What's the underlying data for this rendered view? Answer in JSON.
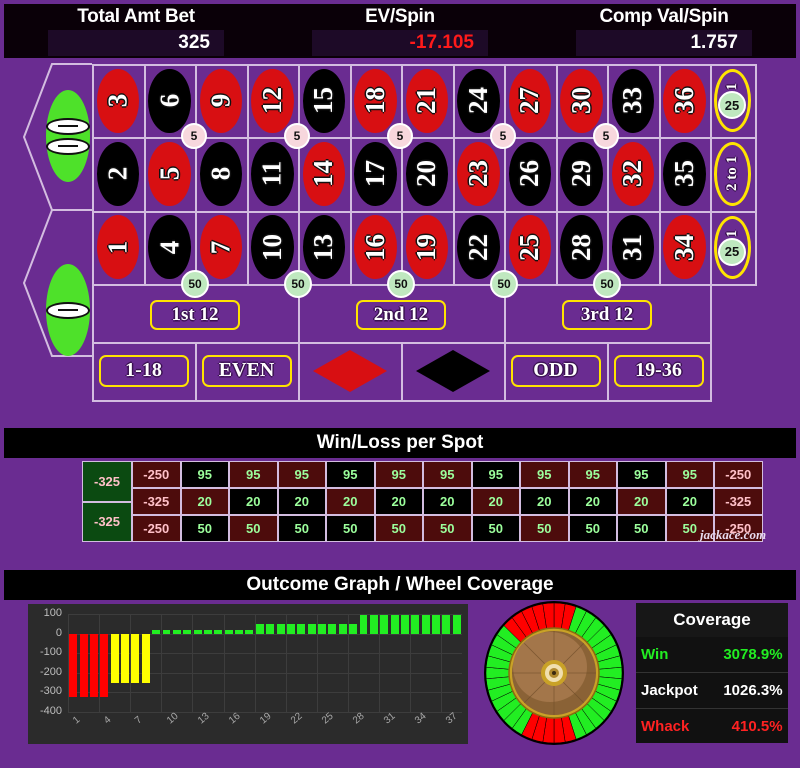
{
  "header": {
    "stats": [
      {
        "label": "Total Amt Bet",
        "value": "325",
        "negative": false
      },
      {
        "label": "EV/Spin",
        "value": "-17.105",
        "negative": true
      },
      {
        "label": "Comp Val/Spin",
        "value": "1.757",
        "negative": false
      }
    ]
  },
  "board": {
    "zeros": [
      {
        "label": "00",
        "zeros": 2
      },
      {
        "label": "0",
        "zeros": 1
      }
    ],
    "numbers": [
      {
        "n": "3",
        "color": "red",
        "col": 0,
        "row": 0
      },
      {
        "n": "6",
        "color": "black",
        "col": 1,
        "row": 0
      },
      {
        "n": "9",
        "color": "red",
        "col": 2,
        "row": 0
      },
      {
        "n": "12",
        "color": "red",
        "col": 3,
        "row": 0
      },
      {
        "n": "15",
        "color": "black",
        "col": 4,
        "row": 0
      },
      {
        "n": "18",
        "color": "red",
        "col": 5,
        "row": 0
      },
      {
        "n": "21",
        "color": "red",
        "col": 6,
        "row": 0
      },
      {
        "n": "24",
        "color": "black",
        "col": 7,
        "row": 0
      },
      {
        "n": "27",
        "color": "red",
        "col": 8,
        "row": 0
      },
      {
        "n": "30",
        "color": "red",
        "col": 9,
        "row": 0
      },
      {
        "n": "33",
        "color": "black",
        "col": 10,
        "row": 0
      },
      {
        "n": "36",
        "color": "red",
        "col": 11,
        "row": 0
      },
      {
        "n": "2",
        "color": "black",
        "col": 0,
        "row": 1
      },
      {
        "n": "5",
        "color": "red",
        "col": 1,
        "row": 1
      },
      {
        "n": "8",
        "color": "black",
        "col": 2,
        "row": 1
      },
      {
        "n": "11",
        "color": "black",
        "col": 3,
        "row": 1
      },
      {
        "n": "14",
        "color": "red",
        "col": 4,
        "row": 1
      },
      {
        "n": "17",
        "color": "black",
        "col": 5,
        "row": 1
      },
      {
        "n": "20",
        "color": "black",
        "col": 6,
        "row": 1
      },
      {
        "n": "23",
        "color": "red",
        "col": 7,
        "row": 1
      },
      {
        "n": "26",
        "color": "black",
        "col": 8,
        "row": 1
      },
      {
        "n": "29",
        "color": "black",
        "col": 9,
        "row": 1
      },
      {
        "n": "32",
        "color": "red",
        "col": 10,
        "row": 1
      },
      {
        "n": "35",
        "color": "black",
        "col": 11,
        "row": 1
      },
      {
        "n": "1",
        "color": "red",
        "col": 0,
        "row": 2
      },
      {
        "n": "4",
        "color": "black",
        "col": 1,
        "row": 2
      },
      {
        "n": "7",
        "color": "red",
        "col": 2,
        "row": 2
      },
      {
        "n": "10",
        "color": "black",
        "col": 3,
        "row": 2
      },
      {
        "n": "13",
        "color": "black",
        "col": 4,
        "row": 2
      },
      {
        "n": "16",
        "color": "red",
        "col": 5,
        "row": 2
      },
      {
        "n": "19",
        "color": "red",
        "col": 6,
        "row": 2
      },
      {
        "n": "22",
        "color": "black",
        "col": 7,
        "row": 2
      },
      {
        "n": "25",
        "color": "red",
        "col": 8,
        "row": 2
      },
      {
        "n": "28",
        "color": "black",
        "col": 9,
        "row": 2
      },
      {
        "n": "31",
        "color": "black",
        "col": 10,
        "row": 2
      },
      {
        "n": "34",
        "color": "red",
        "col": 11,
        "row": 2
      }
    ],
    "column_bets": [
      {
        "label": "2 to 1",
        "row": 0,
        "chip": "25"
      },
      {
        "label": "2 to 1",
        "row": 1,
        "chip": null
      },
      {
        "label": "2 to 1",
        "row": 2,
        "chip": "25"
      }
    ],
    "dozens": [
      {
        "label": "1st 12"
      },
      {
        "label": "2nd 12"
      },
      {
        "label": "3rd 12"
      }
    ],
    "even_money": [
      {
        "label": "1-18",
        "kind": "text"
      },
      {
        "label": "EVEN",
        "kind": "text"
      },
      {
        "label": "RED",
        "kind": "diamond-red"
      },
      {
        "label": "BLACK",
        "kind": "diamond-black"
      },
      {
        "label": "ODD",
        "kind": "text"
      },
      {
        "label": "19-36",
        "kind": "text"
      }
    ],
    "split_chips": [
      {
        "value": "5",
        "col": 1
      },
      {
        "value": "5",
        "col": 3
      },
      {
        "value": "5",
        "col": 5
      },
      {
        "value": "5",
        "col": 7
      },
      {
        "value": "5",
        "col": 9
      }
    ],
    "bottom_chips": [
      {
        "value": "50",
        "col": 1
      },
      {
        "value": "50",
        "col": 3
      },
      {
        "value": "50",
        "col": 5
      },
      {
        "value": "50",
        "col": 7
      },
      {
        "value": "50",
        "col": 9
      }
    ]
  },
  "winloss": {
    "title": "Win/Loss per Spot",
    "zero_cells": [
      {
        "value": "-325"
      },
      {
        "value": "-325"
      }
    ],
    "rows": [
      {
        "cells": [
          {
            "value": "-250",
            "color": "red"
          },
          {
            "value": "95",
            "color": "black"
          },
          {
            "value": "95",
            "color": "red"
          },
          {
            "value": "95",
            "color": "red"
          },
          {
            "value": "95",
            "color": "black"
          },
          {
            "value": "95",
            "color": "red"
          },
          {
            "value": "95",
            "color": "red"
          },
          {
            "value": "95",
            "color": "black"
          },
          {
            "value": "95",
            "color": "red"
          },
          {
            "value": "95",
            "color": "red"
          },
          {
            "value": "95",
            "color": "black"
          },
          {
            "value": "95",
            "color": "red"
          },
          {
            "value": "-250",
            "color": "red"
          }
        ]
      },
      {
        "cells": [
          {
            "value": "-325",
            "color": "red"
          },
          {
            "value": "20",
            "color": "red"
          },
          {
            "value": "20",
            "color": "black"
          },
          {
            "value": "20",
            "color": "black"
          },
          {
            "value": "20",
            "color": "red"
          },
          {
            "value": "20",
            "color": "black"
          },
          {
            "value": "20",
            "color": "black"
          },
          {
            "value": "20",
            "color": "red"
          },
          {
            "value": "20",
            "color": "black"
          },
          {
            "value": "20",
            "color": "black"
          },
          {
            "value": "20",
            "color": "red"
          },
          {
            "value": "20",
            "color": "black"
          },
          {
            "value": "-325",
            "color": "red"
          }
        ]
      },
      {
        "cells": [
          {
            "value": "-250",
            "color": "red"
          },
          {
            "value": "50",
            "color": "black"
          },
          {
            "value": "50",
            "color": "red"
          },
          {
            "value": "50",
            "color": "black"
          },
          {
            "value": "50",
            "color": "black"
          },
          {
            "value": "50",
            "color": "red"
          },
          {
            "value": "50",
            "color": "red"
          },
          {
            "value": "50",
            "color": "black"
          },
          {
            "value": "50",
            "color": "red"
          },
          {
            "value": "50",
            "color": "black"
          },
          {
            "value": "50",
            "color": "black"
          },
          {
            "value": "50",
            "color": "red"
          },
          {
            "value": "-250",
            "color": "red"
          }
        ]
      }
    ],
    "watermark": "jackace.com"
  },
  "outcome": {
    "title": "Outcome Graph / Wheel Coverage",
    "coverage": {
      "title": "Coverage",
      "rows": [
        {
          "name": "Win",
          "count": "30",
          "pct": "78.9%",
          "style": "win"
        },
        {
          "name": "Jackpot",
          "count": "10",
          "pct": "26.3%",
          "style": "jp"
        },
        {
          "name": "Whack",
          "count": "4",
          "pct": "10.5%",
          "style": "wh"
        }
      ]
    }
  },
  "chart_data": {
    "type": "bar",
    "title": "Outcome Graph / Wheel Coverage",
    "xlabel": "",
    "ylabel": "",
    "ylim": [
      -400,
      100
    ],
    "yticks": [
      100,
      0,
      -100,
      -200,
      -300,
      -400
    ],
    "xticks": [
      1,
      4,
      7,
      10,
      13,
      16,
      19,
      22,
      25,
      28,
      31,
      34,
      37
    ],
    "grid": true,
    "categories": [
      "1",
      "2",
      "3",
      "4",
      "5",
      "6",
      "7",
      "8",
      "9",
      "10",
      "11",
      "12",
      "13",
      "14",
      "15",
      "16",
      "17",
      "18",
      "19",
      "20",
      "21",
      "22",
      "23",
      "24",
      "25",
      "26",
      "27",
      "28",
      "29",
      "30",
      "31",
      "32",
      "33",
      "34",
      "35",
      "36",
      "37",
      "38"
    ],
    "values": [
      -325,
      -325,
      -325,
      -325,
      -250,
      -250,
      -250,
      -250,
      20,
      20,
      20,
      20,
      20,
      20,
      20,
      20,
      20,
      20,
      50,
      50,
      50,
      50,
      50,
      50,
      50,
      50,
      50,
      50,
      95,
      95,
      95,
      95,
      95,
      95,
      95,
      95,
      95,
      95
    ],
    "colors": [
      "red",
      "red",
      "red",
      "red",
      "yellow",
      "yellow",
      "yellow",
      "yellow",
      "green",
      "green",
      "green",
      "green",
      "green",
      "green",
      "green",
      "green",
      "green",
      "green",
      "green",
      "green",
      "green",
      "green",
      "green",
      "green",
      "green",
      "green",
      "green",
      "green",
      "green",
      "green",
      "green",
      "green",
      "green",
      "green",
      "green",
      "green",
      "green",
      "green"
    ],
    "color_hex": {
      "red": "#ff0000",
      "yellow": "#ffff00",
      "green": "#22ee22"
    }
  },
  "colors": {
    "background": "#6a2c91",
    "felt": "#6a2c91",
    "table_red": "#d80f12",
    "table_black": "#000000",
    "table_green": "#4ee12a",
    "outline_yellow": "#ffe400",
    "negative": "#ff1a1a"
  }
}
